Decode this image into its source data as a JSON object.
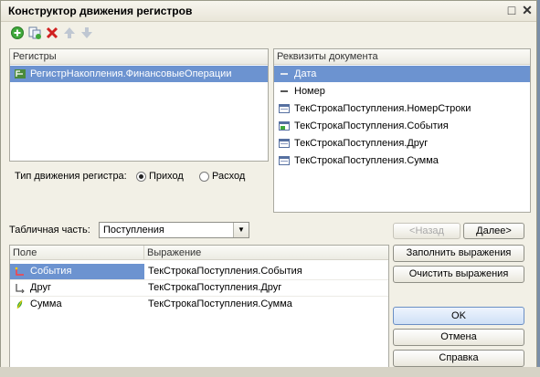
{
  "window": {
    "title": "Конструктор движения регистров"
  },
  "toolbar": {
    "icons": [
      "add-icon",
      "copy-icon",
      "delete-icon",
      "move-up-icon",
      "move-down-icon"
    ]
  },
  "registers": {
    "header": "Регистры",
    "items": [
      {
        "label": "РегистрНакопления.ФинансовыеОперации",
        "selected": true
      }
    ]
  },
  "movement": {
    "label": "Тип движения регистра:",
    "income": "Приход",
    "expense": "Расход",
    "selected": "Приход"
  },
  "requisites": {
    "header": "Реквизиты документа",
    "items": [
      {
        "label": "Дата",
        "icon": "dash-icon",
        "selected": true
      },
      {
        "label": "Номер",
        "icon": "dash-icon"
      },
      {
        "label": "ТекСтрокаПоступления.НомерСтроки",
        "icon": "field-icon"
      },
      {
        "label": "ТекСтрокаПоступления.События",
        "icon": "field-icon"
      },
      {
        "label": "ТекСтрокаПоступления.Друг",
        "icon": "field-icon"
      },
      {
        "label": "ТекСтрокаПоступления.Сумма",
        "icon": "field-icon"
      }
    ]
  },
  "tabular": {
    "label": "Табличная часть:",
    "value": "Поступления"
  },
  "nav": {
    "back": "<Назад",
    "next": "Далее>"
  },
  "grid": {
    "columns": [
      "Поле",
      "Выражение"
    ],
    "rows": [
      {
        "field": "События",
        "expr": "ТекСтрокаПоступления.События",
        "icon": "dimension-icon",
        "selected": true
      },
      {
        "field": "Друг",
        "expr": "ТекСтрокаПоступления.Друг",
        "icon": "dimension-icon"
      },
      {
        "field": "Сумма",
        "expr": "ТекСтрокаПоступления.Сумма",
        "icon": "resource-icon"
      }
    ]
  },
  "actions": {
    "fill": "Заполнить выражения",
    "clear": "Очистить выражения",
    "ok": "OK",
    "cancel": "Отмена",
    "help": "Справка"
  }
}
